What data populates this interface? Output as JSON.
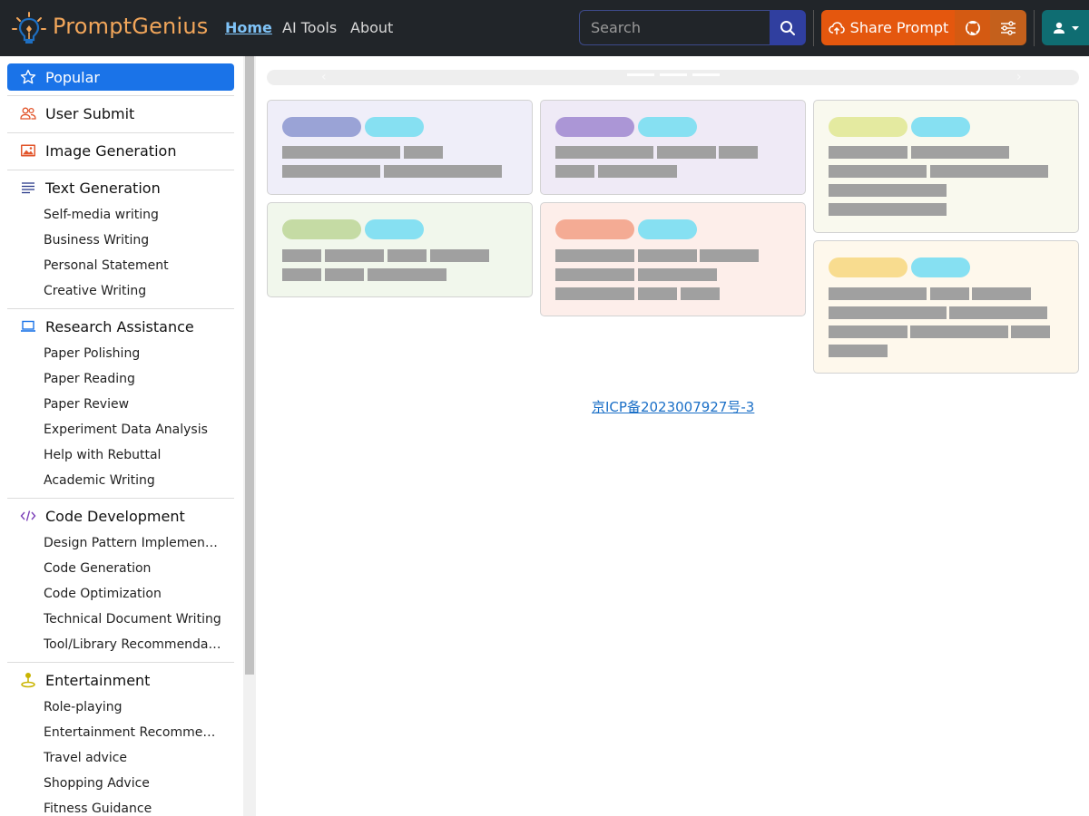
{
  "header": {
    "brand": "PromptGenius",
    "nav": [
      {
        "label": "Home",
        "active": true
      },
      {
        "label": "AI Tools",
        "active": false
      },
      {
        "label": "About",
        "active": false
      }
    ],
    "search_placeholder": "Search",
    "share_label": "Share Prompt",
    "icons": [
      "lightbulb-logo-icon",
      "search-icon",
      "cloud-upload-icon",
      "github-icon",
      "sliders-icon",
      "user-icon",
      "caret-down-icon"
    ]
  },
  "sidebar": {
    "categories": [
      {
        "label": "Popular",
        "icon": "star-icon",
        "active": true,
        "items": []
      },
      {
        "label": "User Submit",
        "icon": "users-icon",
        "active": false,
        "items": []
      },
      {
        "label": "Image Generation",
        "icon": "image-icon",
        "active": false,
        "items": []
      },
      {
        "label": "Text Generation",
        "icon": "text-lines-icon",
        "active": false,
        "items": [
          "Self-media writing",
          "Business Writing",
          "Personal Statement",
          "Creative Writing"
        ]
      },
      {
        "label": "Research Assistance",
        "icon": "laptop-icon",
        "active": false,
        "items": [
          "Paper Polishing",
          "Paper Reading",
          "Paper Review",
          "Experiment Data Analysis",
          "Help with Rebuttal",
          "Academic Writing"
        ]
      },
      {
        "label": "Code Development",
        "icon": "code-icon",
        "active": false,
        "items": [
          "Design Pattern Implementa...",
          "Code Generation",
          "Code Optimization",
          "Technical Document Writing",
          "Tool/Library Recommendati..."
        ]
      },
      {
        "label": "Entertainment",
        "icon": "joystick-icon",
        "active": false,
        "items": [
          "Role-playing",
          "Entertainment Recommend...",
          "Travel advice",
          "Shopping Advice",
          "Fitness Guidance"
        ]
      }
    ]
  },
  "colors": {
    "header_bg": "#212529",
    "brand": "#f2a65a",
    "active_nav": "#7fc3f7",
    "share": "#e4570e",
    "sidebar_active": "#1a73e8"
  },
  "footer": {
    "icp": "京ICP备2023007927号-3"
  }
}
